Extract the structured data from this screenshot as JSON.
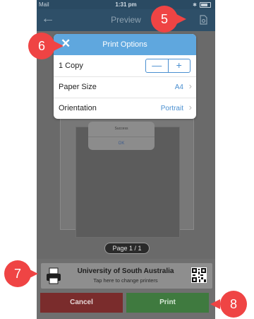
{
  "status_bar": {
    "carrier": "Mail",
    "time": "1:31 pm"
  },
  "navbar": {
    "title": "Preview"
  },
  "preview": {
    "ghost_alert_text": "Success",
    "ghost_alert_ok": "OK",
    "page_indicator": "Page 1 / 1"
  },
  "print_options": {
    "title": "Print Options",
    "copies_label": "1 Copy",
    "minus": "—",
    "plus": "+",
    "paper_size_label": "Paper Size",
    "paper_size_value": "A4",
    "orientation_label": "Orientation",
    "orientation_value": "Portrait"
  },
  "printer": {
    "name": "University of South Australia",
    "hint": "Tap here to change printers"
  },
  "buttons": {
    "cancel": "Cancel",
    "print": "Print"
  },
  "callouts": [
    "5",
    "6",
    "7",
    "8"
  ],
  "colors": {
    "accent": "#5fa7de",
    "callout": "#ef4444",
    "cancel": "#7a2c2c",
    "print": "#3f7a3f",
    "navbar": "#2e4f68"
  }
}
